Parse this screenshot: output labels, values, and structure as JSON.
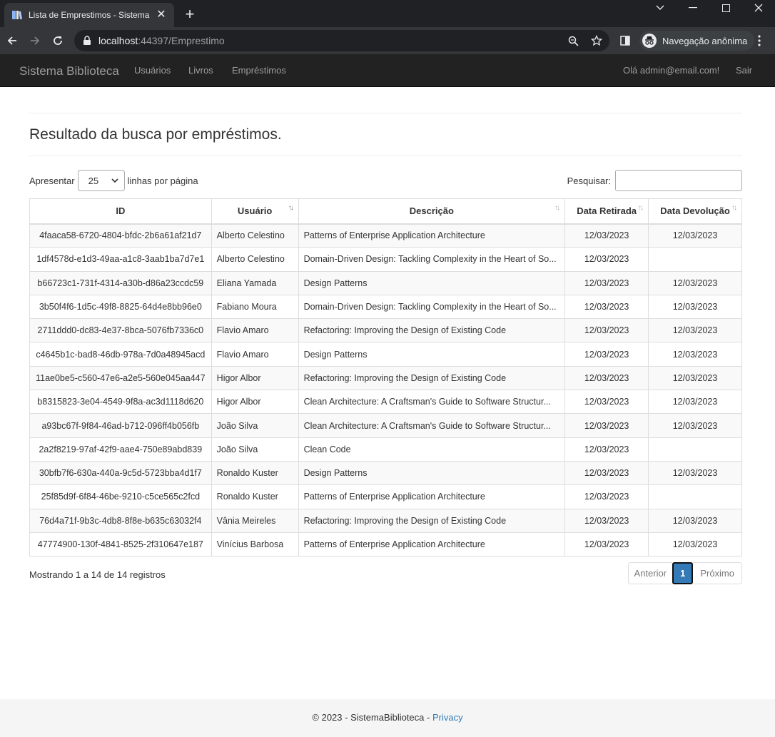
{
  "browser": {
    "tab_title": "Lista de Emprestimos - Sistema B",
    "url_host": "localhost",
    "url_port_path": ":44397/Emprestimo",
    "incognito_label": "Navegação anônima"
  },
  "navbar": {
    "brand": "Sistema Biblioteca",
    "links": [
      "Usuários",
      "Livros",
      "Empréstimos"
    ],
    "greeting": "Olá admin@email.com!",
    "logout": "Sair"
  },
  "page": {
    "title": "Resultado da busca por empréstimos."
  },
  "table_controls": {
    "show_prefix": "Apresentar",
    "page_length": "25",
    "show_suffix": "linhas por página",
    "search_label": "Pesquisar:",
    "search_value": ""
  },
  "table": {
    "headers": [
      "ID",
      "Usuário",
      "Descrição",
      "Data Retirada",
      "Data Devolução"
    ],
    "rows": [
      [
        "4faaca58-6720-4804-bfdc-2b6a61af21d7",
        "Alberto Celestino",
        "Patterns of Enterprise Application Architecture",
        "12/03/2023",
        "12/03/2023"
      ],
      [
        "1df4578d-e1d3-49aa-a1c8-3aab1ba7d7e1",
        "Alberto Celestino",
        "Domain-Driven Design: Tackling Complexity in the Heart of So...",
        "12/03/2023",
        ""
      ],
      [
        "b66723c1-731f-4314-a30b-d86a23ccdc59",
        "Eliana Yamada",
        "Design Patterns",
        "12/03/2023",
        "12/03/2023"
      ],
      [
        "3b50f4f6-1d5c-49f8-8825-64d4e8bb96e0",
        "Fabiano Moura",
        "Domain-Driven Design: Tackling Complexity in the Heart of So...",
        "12/03/2023",
        "12/03/2023"
      ],
      [
        "2711ddd0-dc83-4e37-8bca-5076fb7336c0",
        "Flavio Amaro",
        "Refactoring: Improving the Design of Existing Code",
        "12/03/2023",
        "12/03/2023"
      ],
      [
        "c4645b1c-bad8-46db-978a-7d0a48945acd",
        "Flavio Amaro",
        "Design Patterns",
        "12/03/2023",
        "12/03/2023"
      ],
      [
        "11ae0be5-c560-47e6-a2e5-560e045aa447",
        "Higor Albor",
        "Refactoring: Improving the Design of Existing Code",
        "12/03/2023",
        "12/03/2023"
      ],
      [
        "b8315823-3e04-4549-9f8a-ac3d1118d620",
        "Higor Albor",
        "Clean Architecture: A Craftsman's Guide to Software Structur...",
        "12/03/2023",
        "12/03/2023"
      ],
      [
        "a93bc67f-9f84-46ad-b712-096ff4b056fb",
        "João Silva",
        "Clean Architecture: A Craftsman's Guide to Software Structur...",
        "12/03/2023",
        "12/03/2023"
      ],
      [
        "2a2f8219-97af-42f9-aae4-750e89abd839",
        "João Silva",
        "Clean Code",
        "12/03/2023",
        ""
      ],
      [
        "30bfb7f6-630a-440a-9c5d-5723bba4d1f7",
        "Ronaldo Kuster",
        "Design Patterns",
        "12/03/2023",
        "12/03/2023"
      ],
      [
        "25f85d9f-6f84-46be-9210-c5ce565c2fcd",
        "Ronaldo Kuster",
        "Patterns of Enterprise Application Architecture",
        "12/03/2023",
        ""
      ],
      [
        "76d4a71f-9b3c-4db8-8f8e-b635c63032f4",
        "Vânia Meireles",
        "Refactoring: Improving the Design of Existing Code",
        "12/03/2023",
        "12/03/2023"
      ],
      [
        "47774900-130f-4841-8525-2f310647e187",
        "Vinícius Barbosa",
        "Patterns of Enterprise Application Architecture",
        "12/03/2023",
        "12/03/2023"
      ]
    ]
  },
  "table_footer": {
    "info": "Mostrando 1 a 14 de 14 registros",
    "prev": "Anterior",
    "current_page": "1",
    "next": "Próximo"
  },
  "footer": {
    "copyright": "© 2023 - SistemaBiblioteca - ",
    "privacy": "Privacy"
  },
  "colors": {
    "navbar_bg": "#222222",
    "link": "#337ab7",
    "chrome_dark": "#202124"
  }
}
